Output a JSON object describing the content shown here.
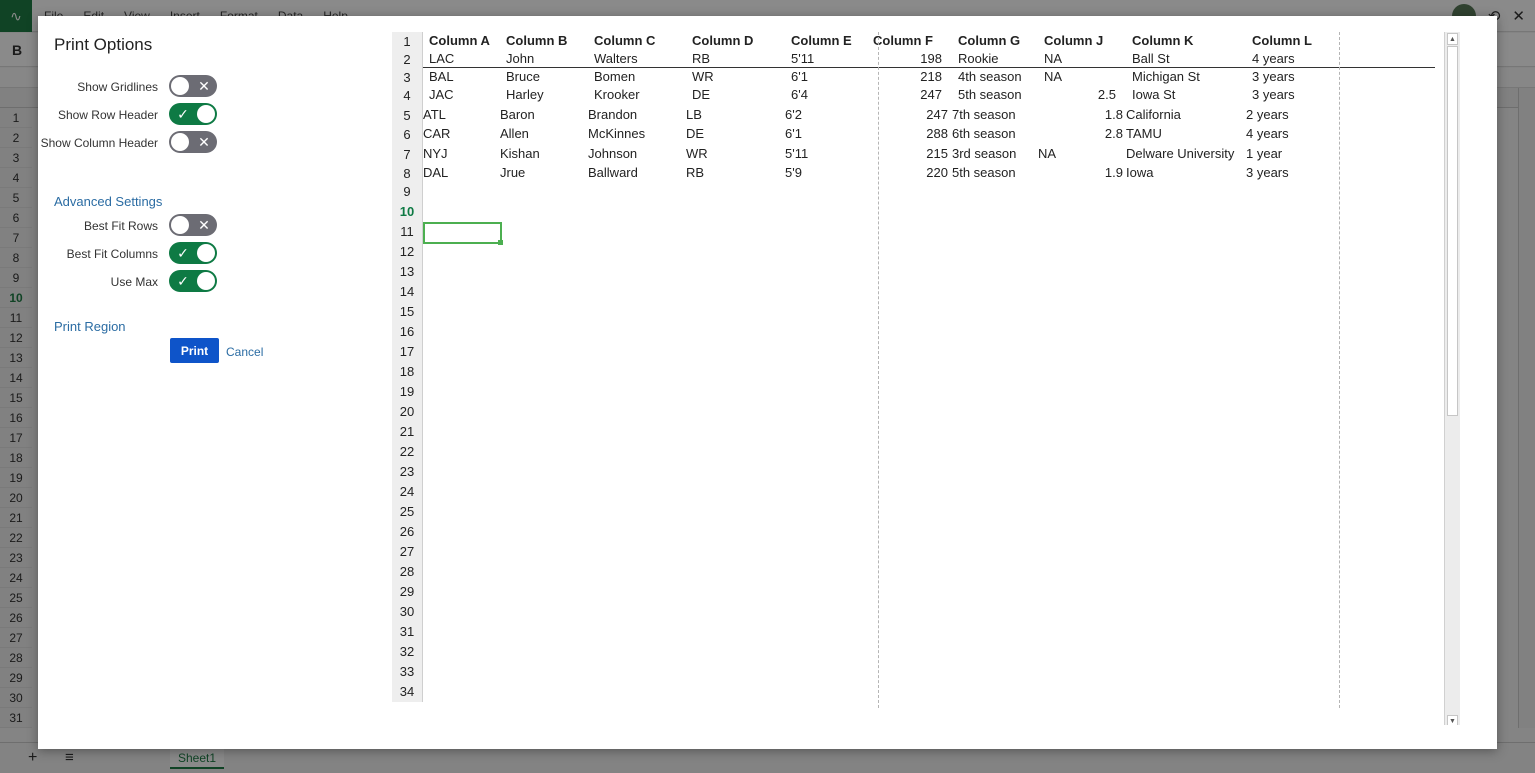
{
  "background": {
    "menu": [
      "File",
      "Edit",
      "View",
      "Insert",
      "Format",
      "Data",
      "Help"
    ],
    "toolbar_first": "B",
    "row_numbers": [
      "1",
      "2",
      "3",
      "4",
      "5",
      "6",
      "7",
      "8",
      "9",
      "10",
      "11",
      "12",
      "13",
      "14",
      "15",
      "16",
      "17",
      "18",
      "19",
      "20",
      "21",
      "22",
      "23",
      "24",
      "25",
      "26",
      "27",
      "28",
      "29",
      "30",
      "31"
    ],
    "active_row": "10",
    "sheet_tab": "Sheet1",
    "add_sheet": "+",
    "sheets_menu": "≡"
  },
  "dialog": {
    "title": "Print Options",
    "options": [
      {
        "label": "Show Gridlines",
        "on": false
      },
      {
        "label": "Show Row Header",
        "on": true
      },
      {
        "label": "Show Column Header",
        "on": false
      }
    ],
    "advanced_title": "Advanced Settings",
    "advanced": [
      {
        "label": "Best Fit Rows",
        "on": false
      },
      {
        "label": "Best Fit Columns",
        "on": true
      },
      {
        "label": "Use Max",
        "on": true
      }
    ],
    "region_title": "Print Region",
    "print_label": "Print",
    "cancel_label": "Cancel",
    "toggle_on_glyph": "✓",
    "toggle_off_glyph": "✕"
  },
  "preview": {
    "active_row": "10",
    "headers": [
      "Column A",
      "Column B",
      "Column C",
      "Column D",
      "Column E",
      "Column F",
      "Column G",
      "Column J",
      "Column K",
      "Column L"
    ],
    "rows": [
      [
        "LAC",
        "John",
        "Walters",
        "RB",
        "5'11",
        "198",
        "Rookie",
        "NA",
        "Ball St",
        "4 years"
      ],
      [
        "BAL",
        "Bruce",
        "Bomen",
        "WR",
        "6'1",
        "218",
        "4th season",
        "NA",
        "Michigan St",
        "3 years"
      ],
      [
        "JAC",
        "Harley",
        "Krooker",
        "DE",
        "6'4",
        "247",
        "5th season",
        "2.5",
        "Iowa St",
        "3 years"
      ],
      [
        "ATL",
        "Baron",
        "Brandon",
        "LB",
        "6'2",
        "247",
        "7th season",
        "1.8",
        "California",
        "2 years"
      ],
      [
        "CAR",
        "Allen",
        "McKinnes",
        "DE",
        "6'1",
        "288",
        "6th season",
        "2.8",
        "TAMU",
        "4 years"
      ],
      [
        "NYJ",
        "Kishan",
        "Johnson",
        "WR",
        "5'11",
        "215",
        "3rd season",
        "NA",
        "Delware University",
        "1 year"
      ],
      [
        "DAL",
        "Jrue",
        "Ballward",
        "RB",
        "5'9",
        "220",
        "5th season",
        "1.9",
        "Iowa",
        "3 years"
      ]
    ],
    "row_numbers": [
      "1",
      "2",
      "3",
      "4",
      "5",
      "6",
      "7",
      "8",
      "9",
      "10",
      "11",
      "12",
      "13",
      "14",
      "15",
      "16",
      "17",
      "18",
      "19",
      "20",
      "21",
      "22",
      "23",
      "24",
      "25",
      "26",
      "27",
      "28",
      "29",
      "30",
      "31",
      "32",
      "33",
      "34"
    ]
  },
  "icons": {
    "close": "✕",
    "history": "⟲",
    "scroll_up": "▲",
    "scroll_down": "▼",
    "scroll_left": "◀",
    "scroll_right": "▶"
  }
}
